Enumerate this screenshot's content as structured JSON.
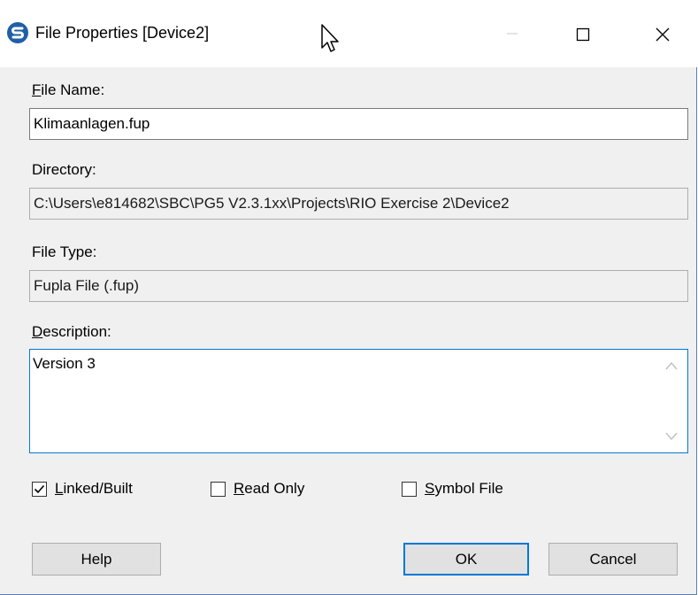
{
  "window": {
    "title": "File Properties [Device2]",
    "brand_color": "#1f5fa8",
    "focus_color": "#0078d7",
    "controls": {
      "minimize_icon": "minimize-icon",
      "maximize_icon": "maximize-icon",
      "close_icon": "close-icon"
    }
  },
  "fields": {
    "file_name": {
      "label_first": "F",
      "label_rest": "ile Name:",
      "value": "Klimaanlagen.fup"
    },
    "directory": {
      "label": "Directory:",
      "value": "C:\\Users\\e814682\\SBC\\PG5 V2.3.1xx\\Projects\\RIO Exercise 2\\Device2"
    },
    "file_type": {
      "label": "File Type:",
      "value": "Fupla File (.fup)"
    },
    "description": {
      "label_first": "D",
      "label_rest": "escription:",
      "value": "Version 3"
    }
  },
  "checkboxes": [
    {
      "label_first": "L",
      "label_rest": "inked/Built",
      "checked": true
    },
    {
      "label_first": "R",
      "label_rest": "ead Only",
      "checked": false
    },
    {
      "label_first": "S",
      "label_rest": "ymbol File",
      "checked": false
    }
  ],
  "buttons": {
    "help": "Help",
    "ok": "OK",
    "cancel": "Cancel"
  }
}
